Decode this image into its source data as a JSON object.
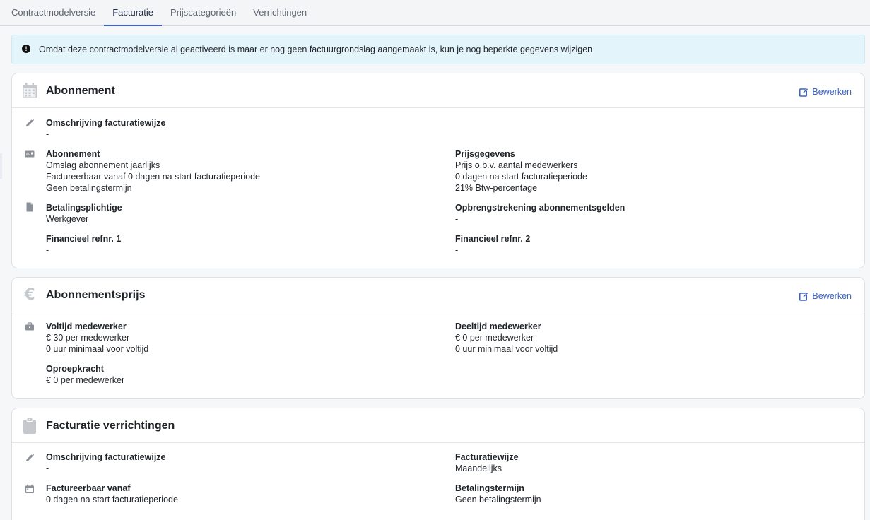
{
  "tabs": [
    {
      "label": "Contractmodelversie"
    },
    {
      "label": "Facturatie"
    },
    {
      "label": "Prijscategorieën"
    },
    {
      "label": "Verrichtingen"
    }
  ],
  "alert": {
    "icon": "exclamation-circle-icon",
    "text": "Omdat deze contractmodelversie al geactiveerd is maar er nog geen factuurgrondslag aangemaakt is, kun je nog beperkte gegevens wijzigen"
  },
  "abonnement": {
    "title": "Abonnement",
    "edit_label": "Bewerken",
    "omschrijving": {
      "label": "Omschrijving facturatiewijze",
      "value": "-"
    },
    "abonnement_field": {
      "label": "Abonnement",
      "line1": "Omslag abonnement jaarlijks",
      "line2": "Factureerbaar vanaf 0 dagen na start facturatieperiode",
      "line3": "Geen betalingstermijn"
    },
    "prijsgegevens": {
      "label": "Prijsgegevens",
      "line1": "Prijs o.b.v. aantal medewerkers",
      "line2": "0 dagen na start facturatieperiode",
      "line3": "21% Btw-percentage"
    },
    "betalingsplichtige": {
      "label": "Betalingsplichtige",
      "value": "Werkgever"
    },
    "opbrengstrekening": {
      "label": "Opbrengstrekening abonnementsgelden",
      "value": "-"
    },
    "refnr1": {
      "label": "Financieel refnr. 1",
      "value": "-"
    },
    "refnr2": {
      "label": "Financieel refnr. 2",
      "value": "-"
    }
  },
  "abonnementsprijs": {
    "title": "Abonnementsprijs",
    "edit_label": "Bewerken",
    "voltijd": {
      "label": "Voltijd medewerker",
      "line1": "€ 30 per medewerker",
      "line2": "0 uur minimaal voor voltijd"
    },
    "deeltijd": {
      "label": "Deeltijd medewerker",
      "line1": "€ 0 per medewerker",
      "line2": "0 uur minimaal voor voltijd"
    },
    "oproepkracht": {
      "label": "Oproepkracht",
      "line1": "€ 0 per medewerker"
    }
  },
  "verrichtingen": {
    "title": "Facturatie verrichtingen",
    "omschrijving": {
      "label": "Omschrijving facturatiewijze",
      "value": "-"
    },
    "facturatiewijze": {
      "label": "Facturatiewijze",
      "value": "Maandelijks"
    },
    "factureerbaar": {
      "label": "Factureerbaar vanaf",
      "value": "0 dagen na start facturatieperiode"
    },
    "betalingstermijn": {
      "label": "Betalingstermijn",
      "value": "Geen betalingstermijn"
    }
  },
  "colors": {
    "accent": "#3f5fd3",
    "link": "#3a63c7",
    "alert_bg": "#e4f4fb",
    "icon_gray": "#bfc3c9"
  }
}
